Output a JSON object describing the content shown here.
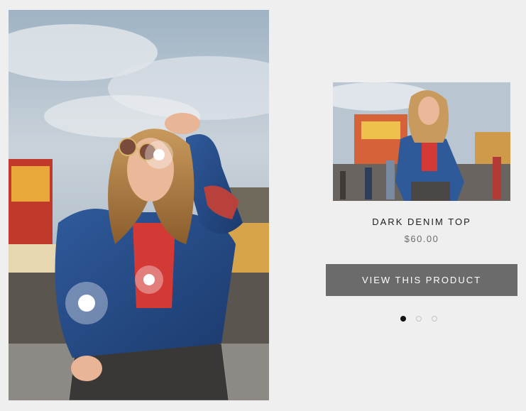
{
  "product": {
    "title": "DARK DENIM TOP",
    "price": "$60.00",
    "button_label": "VIEW THIS PRODUCT"
  },
  "carousel": {
    "slides": 3,
    "active_index": 0
  },
  "hotspots": [
    {
      "name": "sunglasses"
    },
    {
      "name": "top"
    },
    {
      "name": "jacket"
    }
  ],
  "colors": {
    "background": "#efefef",
    "button": "#6b6b6b",
    "dot_active": "#111111",
    "dot_inactive": "#c4c4c4"
  }
}
